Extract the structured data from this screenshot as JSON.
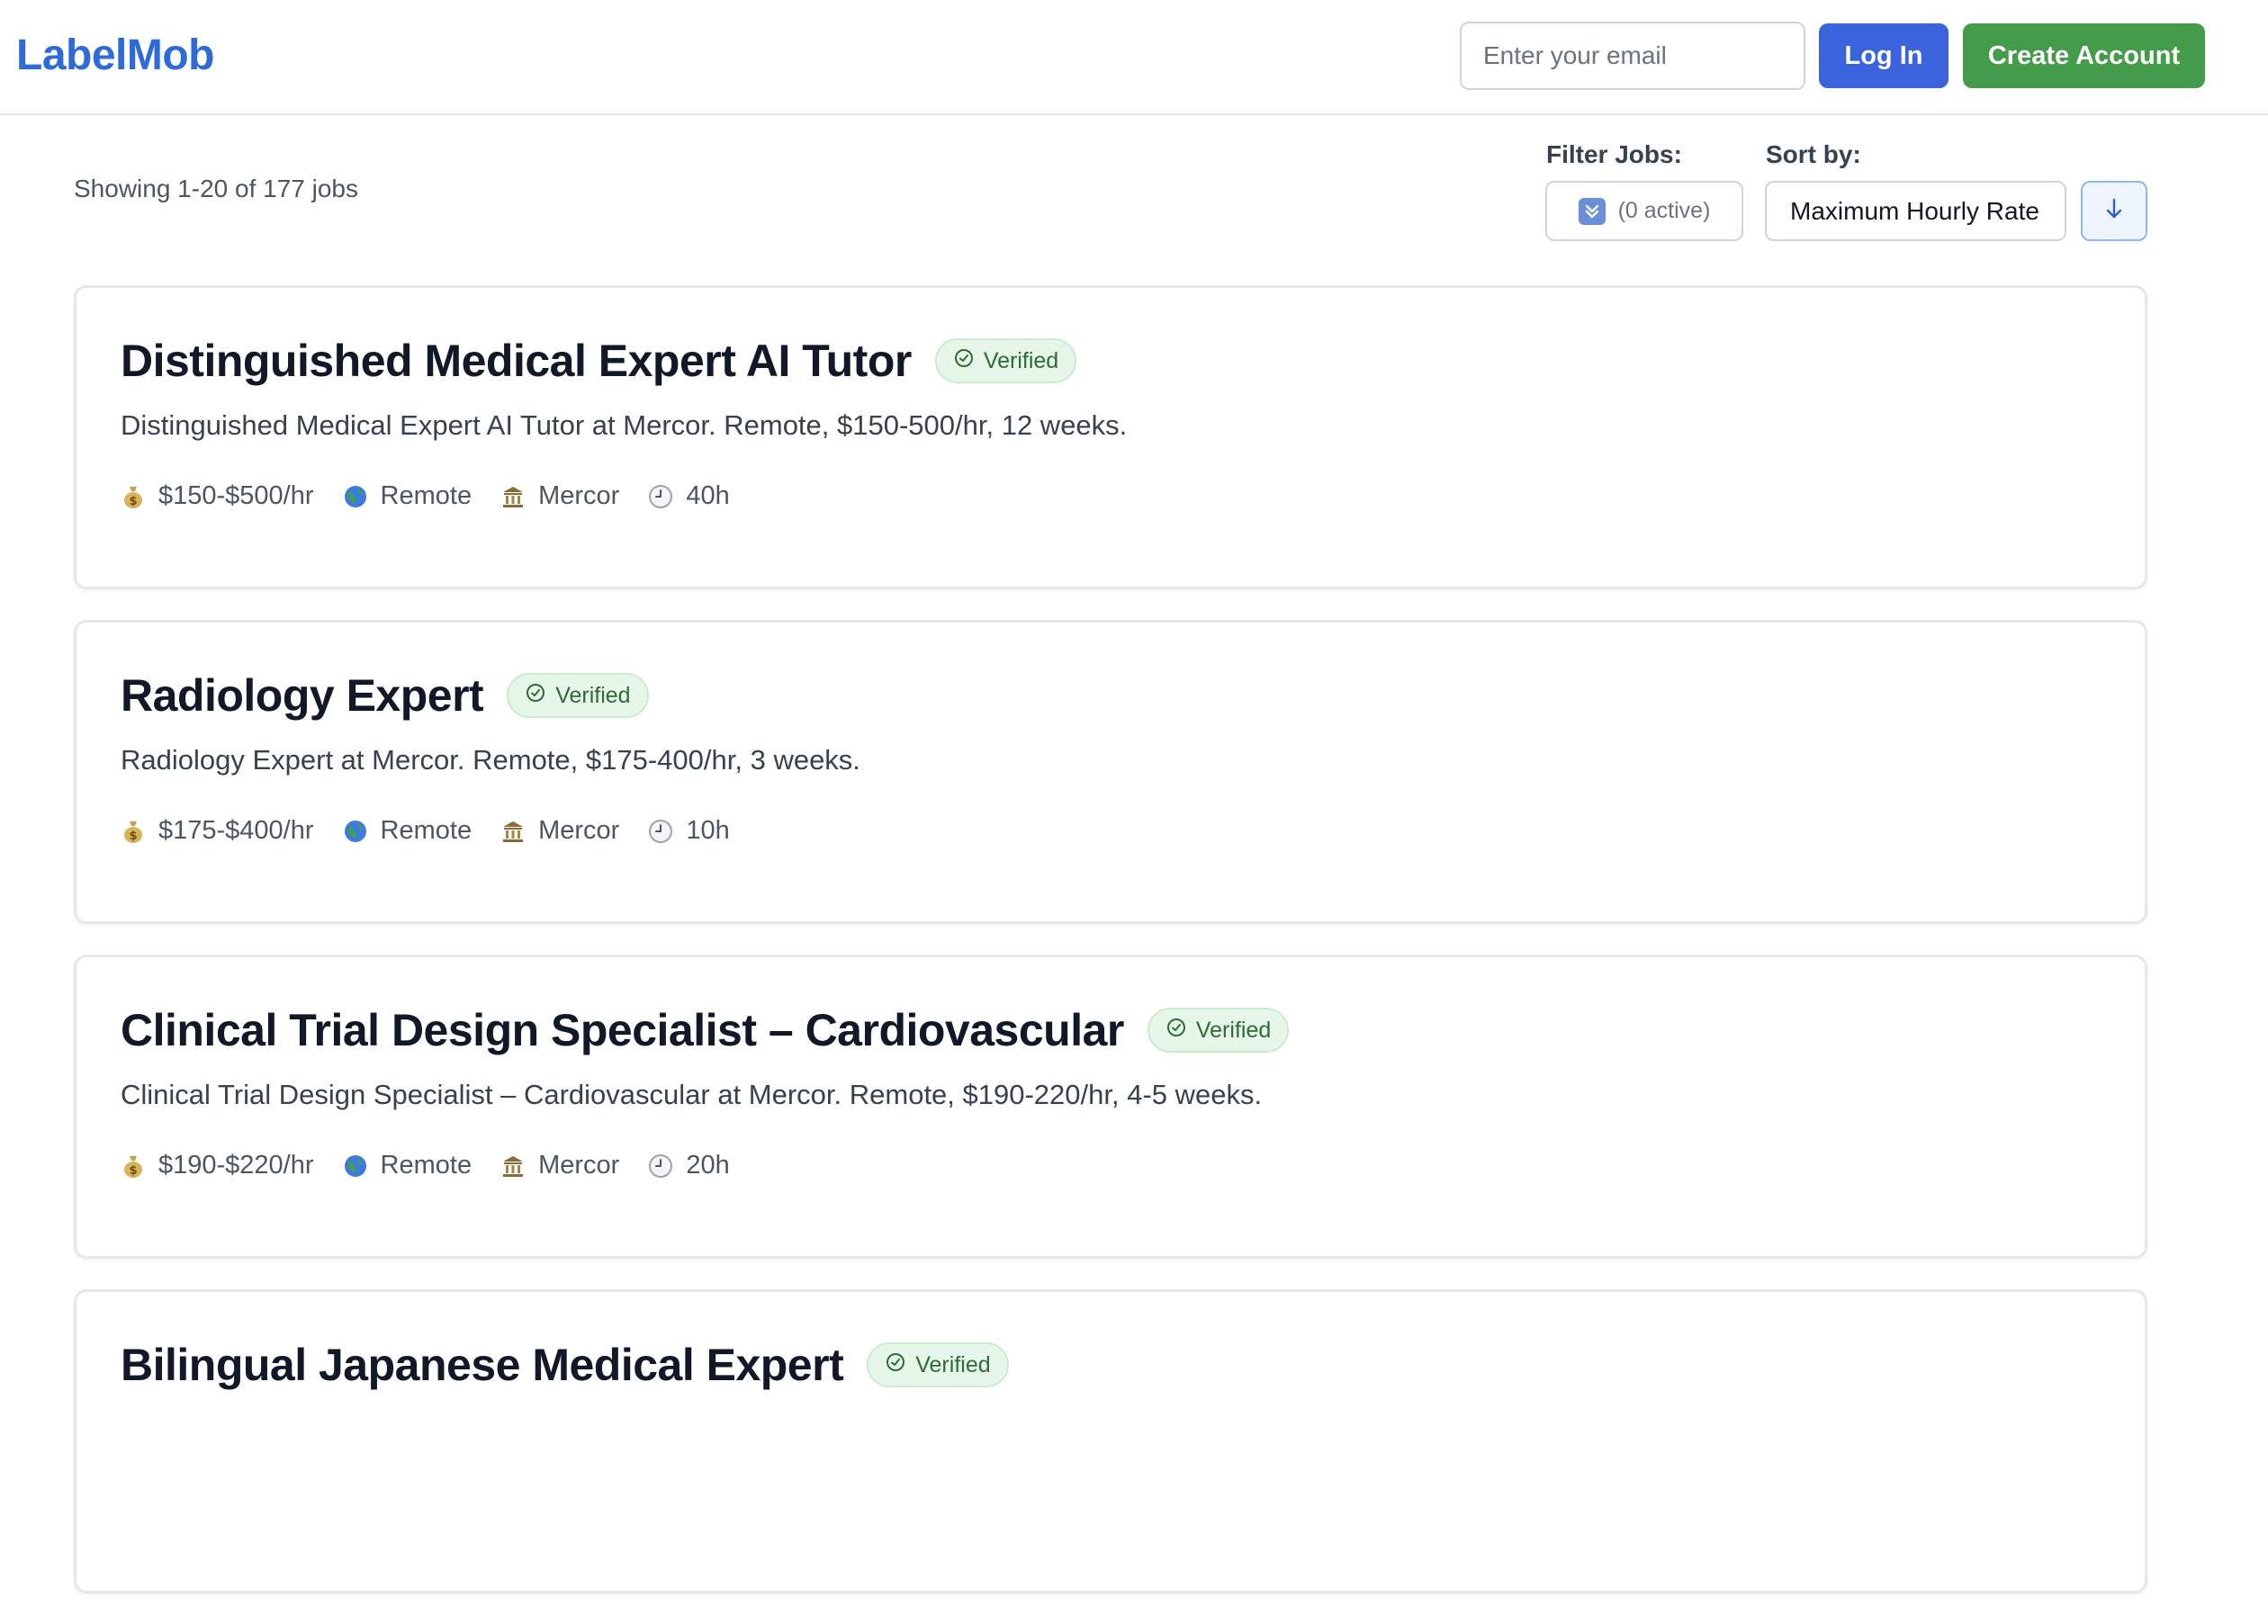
{
  "header": {
    "logo": "LabelMob",
    "email_placeholder": "Enter your email",
    "login_label": "Log In",
    "create_account_label": "Create Account"
  },
  "toolbar": {
    "count_text": "Showing 1-20 of 177 jobs",
    "filter_label": "Filter Jobs:",
    "filter_button_text": "(0 active)",
    "sort_label": "Sort by:",
    "sort_value": "Maximum Hourly Rate",
    "sort_direction": "descending"
  },
  "jobs": [
    {
      "title": "Distinguished Medical Expert AI Tutor",
      "badge": "Verified",
      "description": "Distinguished Medical Expert AI Tutor at Mercor. Remote, $150-500/hr, 12 weeks.",
      "rate": "$150-$500/hr",
      "location": "Remote",
      "company": "Mercor",
      "hours": "40h"
    },
    {
      "title": "Radiology Expert",
      "badge": "Verified",
      "description": "Radiology Expert at Mercor. Remote, $175-400/hr, 3 weeks.",
      "rate": "$175-$400/hr",
      "location": "Remote",
      "company": "Mercor",
      "hours": "10h"
    },
    {
      "title": "Clinical Trial Design Specialist – Cardiovascular",
      "badge": "Verified",
      "description": "Clinical Trial Design Specialist – Cardiovascular at Mercor. Remote, $190-220/hr, 4-5 weeks.",
      "rate": "$190-$220/hr",
      "location": "Remote",
      "company": "Mercor",
      "hours": "20h"
    },
    {
      "title": "Bilingual Japanese Medical Expert",
      "badge": "Verified"
    }
  ],
  "icons": {
    "rate": "money-bag-icon",
    "location": "globe-icon",
    "company": "building-icon",
    "hours": "clock-icon",
    "verified": "check-circle-icon",
    "filter": "filter-icon",
    "sort_direction": "arrow-down-icon"
  },
  "colors": {
    "brand": "#2f6bd8",
    "login_button": "#3b63dc",
    "create_button": "#449b4a",
    "verified_bg": "#e6f6e8",
    "verified_text": "#2f6b36"
  }
}
